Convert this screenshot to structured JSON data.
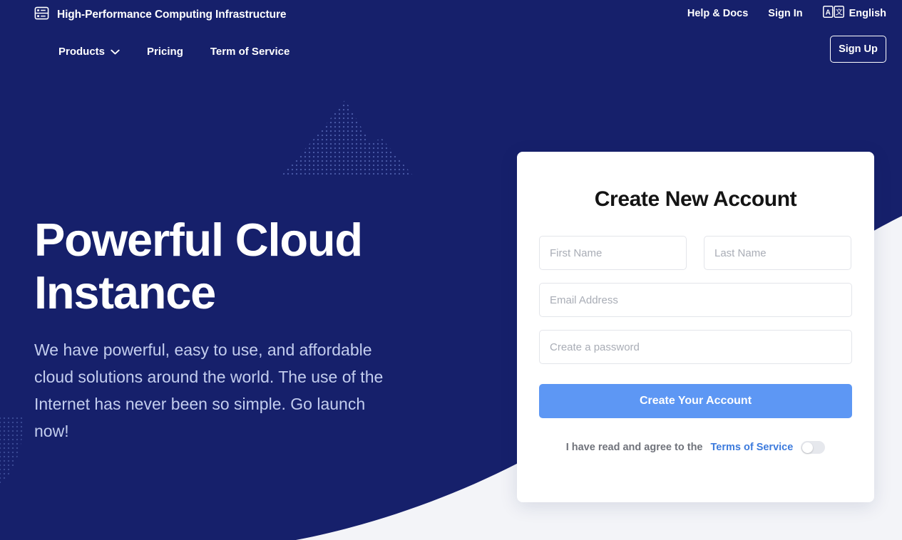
{
  "brand": {
    "icon": "server-rack-icon",
    "title": "High-Performance Computing Infrastructure"
  },
  "topnav": {
    "help": "Help & Docs",
    "signin": "Sign In",
    "language": "English",
    "language_icon": "translate-icon"
  },
  "mainnav": {
    "products": "Products",
    "products_icon": "chevron-down-icon",
    "pricing": "Pricing",
    "terms": "Term of Service",
    "signup": "Sign Up"
  },
  "hero": {
    "heading": "Powerful Cloud Instance",
    "paragraph": "We have powerful, easy to use, and affordable cloud solutions around the world. The use of the Internet has never been so simple. Go launch now!"
  },
  "signup_card": {
    "title": "Create New Account",
    "first_name_placeholder": "First Name",
    "last_name_placeholder": "Last Name",
    "email_placeholder": "Email Address",
    "password_placeholder": "Create a password",
    "first_name_value": "",
    "last_name_value": "",
    "email_value": "",
    "password_value": "",
    "submit_label": "Create Your Account",
    "terms_text": "I have read and agree to the",
    "terms_link": "Terms of Service",
    "terms_toggle_state": "off"
  },
  "colors": {
    "navy": "#16206b",
    "page_background": "#f3f4f8",
    "accent_blue": "#5d97f4",
    "link_blue": "#3d7bdd",
    "hero_paragraph": "#c3cdee",
    "field_border": "#e3e5ea"
  }
}
